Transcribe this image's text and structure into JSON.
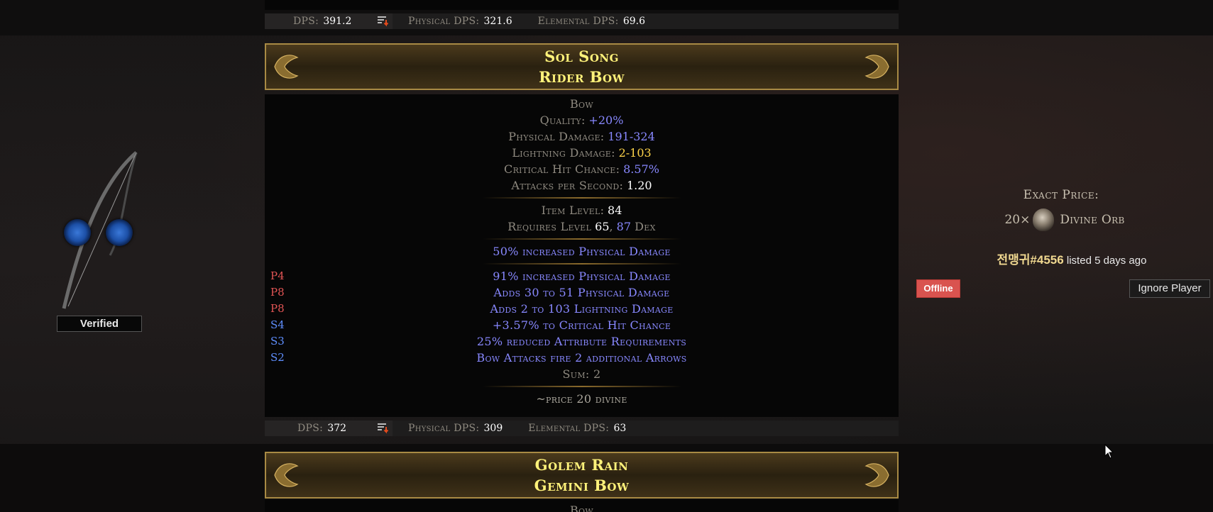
{
  "top_dps_bar": {
    "dps_label": "DPS",
    "dps_value": "391.2",
    "physical_label": "Physical DPS",
    "physical_value": "321.6",
    "elemental_label": "Elemental DPS",
    "elemental_value": "69.6"
  },
  "item": {
    "name": "Sol Song",
    "base": "Rider Bow",
    "category": "Bow",
    "properties": [
      {
        "label": "Quality",
        "value": "+20%",
        "color": "blue"
      },
      {
        "label": "Physical Damage",
        "value": "191-324",
        "color": "blue"
      },
      {
        "label": "Lightning Damage",
        "value": "2-103",
        "color": "yellow"
      },
      {
        "label": "Critical Hit Chance",
        "value": "8.57%",
        "color": "blue"
      },
      {
        "label": "Attacks per Second",
        "value": "1.20",
        "color": "white"
      }
    ],
    "item_level_label": "Item Level",
    "item_level": "84",
    "requires_label": "Requires Level",
    "requires_level": "65",
    "requires_dex": "87",
    "requires_dex_label": "Dex",
    "implicit": "50% increased Physical Damage",
    "mods": [
      {
        "tier": "P4",
        "kind": "prefix",
        "text": "91% increased Physical Damage"
      },
      {
        "tier": "P8",
        "kind": "prefix",
        "text": "Adds 30 to 51 Physical Damage"
      },
      {
        "tier": "P8",
        "kind": "prefix",
        "text": "Adds 2 to 103 Lightning Damage"
      },
      {
        "tier": "S4",
        "kind": "suffix",
        "text": "+3.57% to Critical Hit Chance"
      },
      {
        "tier": "S3",
        "kind": "suffix",
        "text": "25% reduced Attribute Requirements"
      },
      {
        "tier": "S2",
        "kind": "suffix",
        "text": "Bow Attacks fire 2 additional Arrows"
      }
    ],
    "sum_text": "Sum: 2",
    "note": "~price 20 divine"
  },
  "bottom_dps_bar": {
    "dps_label": "DPS",
    "dps_value": "372",
    "physical_label": "Physical DPS",
    "physical_value": "309",
    "elemental_label": "Elemental DPS",
    "elemental_value": "63"
  },
  "next_item": {
    "name": "Golem Rain",
    "base": "Gemini Bow",
    "category": "Bow"
  },
  "listing": {
    "verified_label": "Verified",
    "price_label": "Exact Price:",
    "price_amount": "20×",
    "currency": "Divine Orb",
    "seller": "전맹귀#4556",
    "listed_text": "listed 5 days ago",
    "status": "Offline",
    "ignore_label": "Ignore Player"
  },
  "colors": {
    "unique_name": "#fff27a",
    "magic_mod": "#8888ff",
    "prefix_tier": "#e35555",
    "suffix_tier": "#5f8fff",
    "offline_badge": "#d9534f"
  }
}
